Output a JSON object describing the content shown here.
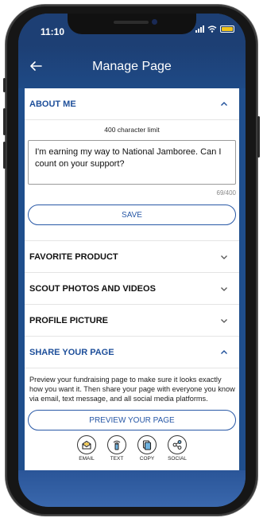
{
  "status_bar": {
    "time": "11:10"
  },
  "header": {
    "title": "Manage Page"
  },
  "about_me": {
    "title": "ABOUT ME",
    "char_limit": "400 character limit",
    "text": "I'm earning my way to National Jamboree. Can I count on your support?",
    "counter": "69/400",
    "save_label": "SAVE"
  },
  "sections": {
    "favorite_product": "FAVORITE PRODUCT",
    "scout_photos": "SCOUT PHOTOS AND VIDEOS",
    "profile_picture": "PROFILE PICTURE"
  },
  "share": {
    "title": "SHARE YOUR PAGE",
    "description": "Preview your fundraising page to make sure it looks exactly how you want it. Then share your page with everyone you know via email, text message, and all social media platforms.",
    "preview_label": "PREVIEW YOUR PAGE",
    "options": [
      {
        "label": "EMAIL",
        "icon": "email-icon"
      },
      {
        "label": "TEXT",
        "icon": "text-message-icon"
      },
      {
        "label": "COPY",
        "icon": "copy-icon"
      },
      {
        "label": "SOCIAL",
        "icon": "social-share-icon"
      }
    ]
  },
  "colors": {
    "header": "#1d3f74",
    "accent": "#1e4f9a",
    "battery": "#f3c419"
  }
}
